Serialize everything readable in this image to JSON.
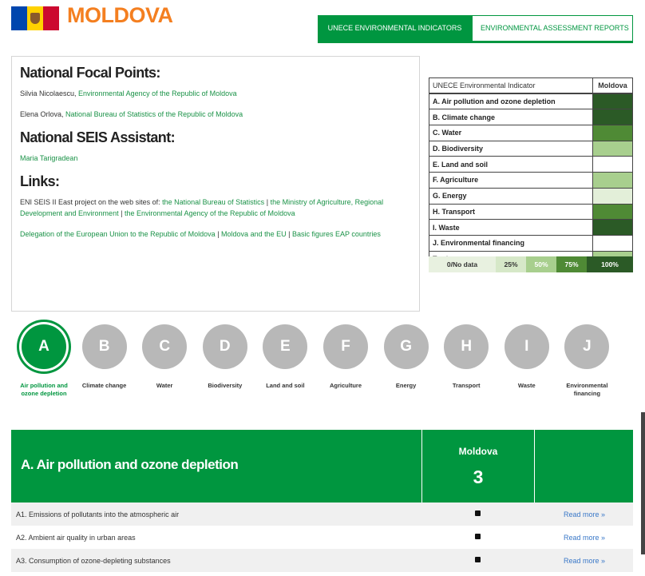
{
  "header": {
    "country": "MOLDOVA",
    "tabs": [
      {
        "label": "UNECE ENVIRONMENTAL INDICATORS",
        "active": true
      },
      {
        "label": "ENVIRONMENTAL ASSESSMENT REPORTS",
        "active": false
      }
    ],
    "accent_color": "#009640",
    "title_color": "#f47f20"
  },
  "info": {
    "focal_heading": "National Focal Points:",
    "focal1_name": "Silvia Nicolaescu,",
    "focal1_org": "Environmental Agency of the Republic of Moldova",
    "focal2_name": "Elena Orlova,",
    "focal2_org": "National Bureau of Statistics of the Republic of Moldova",
    "seis_heading": "National SEIS Assistant:",
    "seis_name": "Maria Tarigradean",
    "links_heading": "Links:",
    "links_intro": "ENI SEIS II East project on the web sites of:",
    "link1": "the National Bureau of Statistics",
    "link2": "the Ministry of Agriculture, Regional Development and Environment",
    "link3": "the Environmental Agency of the Republic of Moldova",
    "link4": "Delegation of the European Union to the Republic of Moldova",
    "link5": "Moldova and the EU",
    "link6": "Basic figures EAP countries",
    "sep": "|"
  },
  "indicator_table": {
    "header_label": "UNECE Environmental Indicator",
    "header_country": "Moldova",
    "rows": [
      {
        "label": "A. Air pollution and ozone depletion",
        "color": "#2b5a26"
      },
      {
        "label": "B. Climate change",
        "color": "#2b5a26"
      },
      {
        "label": "C. Water",
        "color": "#4f8a35"
      },
      {
        "label": "D. Biodiversity",
        "color": "#a8cf8e"
      },
      {
        "label": "E. Land and soil",
        "color": "#ffffff"
      },
      {
        "label": "F. Agriculture",
        "color": "#a8cf8e"
      },
      {
        "label": "G. Energy",
        "color": "#e3efd9"
      },
      {
        "label": "H. Transport",
        "color": "#4f8a35"
      },
      {
        "label": "I. Waste",
        "color": "#2b5a26"
      },
      {
        "label": "J. Environmental financing",
        "color": "#ffffff"
      }
    ],
    "total_label": "Total",
    "total_color": "#a8cf8e"
  },
  "legend": [
    {
      "label": "0/No data",
      "bg": "#e8f1e0",
      "fg": "#333333"
    },
    {
      "label": "25%",
      "bg": "#d6e8c8",
      "fg": "#333333"
    },
    {
      "label": "50%",
      "bg": "#a8cf8e",
      "fg": "#ffffff"
    },
    {
      "label": "75%",
      "bg": "#4f8a35",
      "fg": "#ffffff"
    },
    {
      "label": "100%",
      "bg": "#2b5a26",
      "fg": "#ffffff"
    }
  ],
  "circles": [
    {
      "letter": "A",
      "label": "Air pollution and ozone depletion",
      "active": true
    },
    {
      "letter": "B",
      "label": "Climate change",
      "active": false
    },
    {
      "letter": "C",
      "label": "Water",
      "active": false
    },
    {
      "letter": "D",
      "label": "Biodiversity",
      "active": false
    },
    {
      "letter": "E",
      "label": "Land and soil",
      "active": false
    },
    {
      "letter": "F",
      "label": "Agriculture",
      "active": false
    },
    {
      "letter": "G",
      "label": "Energy",
      "active": false
    },
    {
      "letter": "H",
      "label": "Transport",
      "active": false
    },
    {
      "letter": "I",
      "label": "Waste",
      "active": false
    },
    {
      "letter": "J",
      "label": "Environmental financing",
      "active": false
    }
  ],
  "section": {
    "title": "A. Air pollution and ozone depletion",
    "country": "Moldova",
    "score": "3",
    "rows": [
      {
        "label": "A1. Emissions of pollutants into the atmospheric air",
        "more": "Read more »"
      },
      {
        "label": "A2. Ambient air quality in urban areas",
        "more": "Read more »"
      },
      {
        "label": "A3. Consumption of ozone-depleting substances",
        "more": "Read more »"
      }
    ]
  }
}
